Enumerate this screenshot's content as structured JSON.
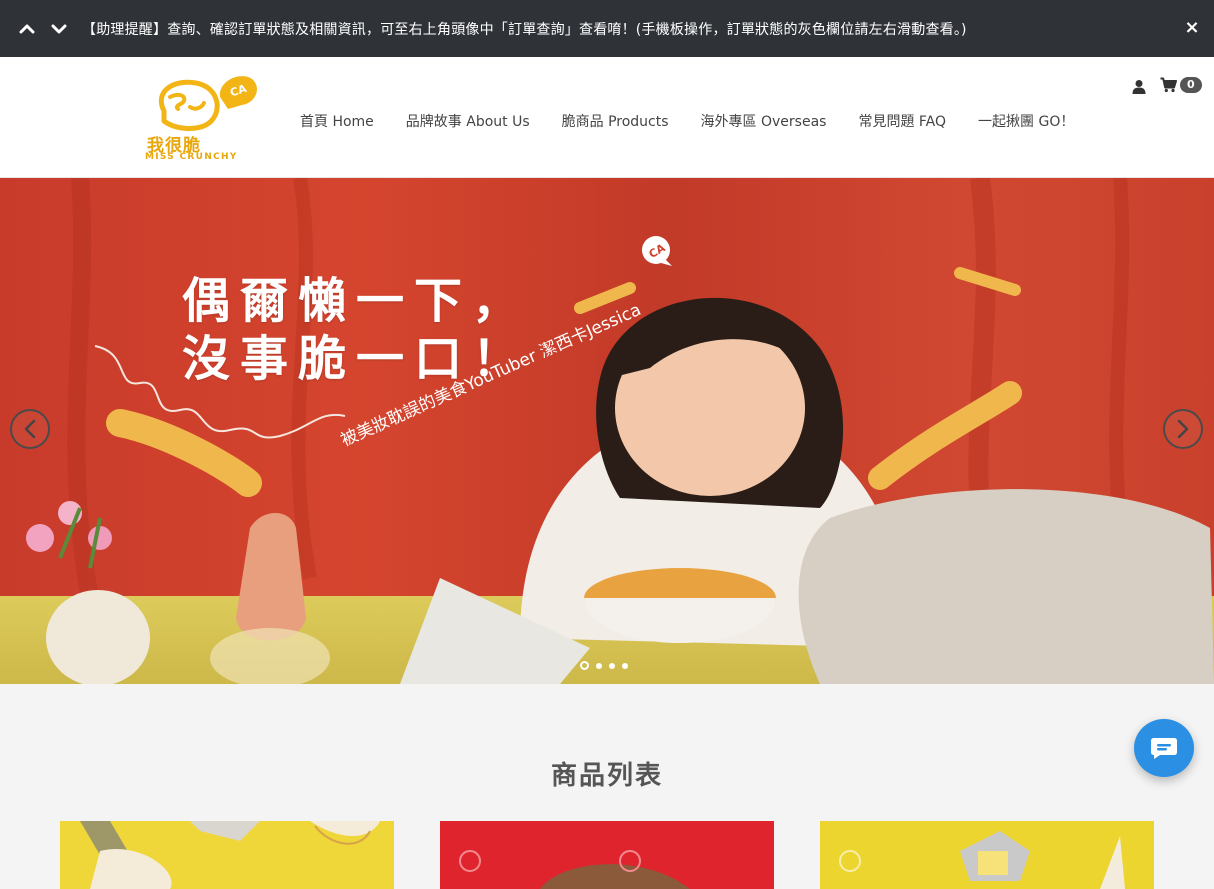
{
  "announcement": {
    "message": "【助理提醒】查詢、確認訂單狀態及相關資訊，可至右上角頭像中「訂單查詢」查看唷！(手機板操作，訂單狀態的灰色欄位請左右滑動查看。)",
    "close": "×"
  },
  "header": {
    "logo_cn": "我很脆",
    "logo_en": "MISS CRUNCHY",
    "nav": [
      "首頁 Home",
      "品牌故事 About Us",
      "脆商品 Products",
      "海外專區 Overseas",
      "常見問題 FAQ",
      "一起揪團 GO！"
    ],
    "cart_count": "0"
  },
  "hero": {
    "heading": "偶爾懶一下，\n沒事脆一口！",
    "subtitle": "被美妝耽誤的美食YouTuber 潔西卡Jessica",
    "slides": 4,
    "active_slide": 1
  },
  "products": {
    "title": "商品列表"
  },
  "colors": {
    "brand": "#e8a80c",
    "topbar": "#2f3338",
    "chat": "#2b8fe3"
  },
  "icons": [
    "chevron-up-icon",
    "chevron-down-icon",
    "close-icon",
    "user-icon",
    "cart-icon",
    "chevron-left-icon",
    "chevron-right-icon",
    "chat-icon"
  ]
}
